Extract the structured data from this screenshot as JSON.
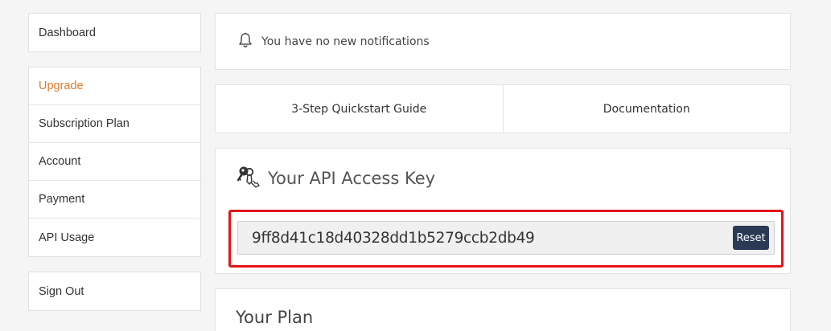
{
  "sidebar": {
    "dashboard": "Dashboard",
    "items": [
      "Upgrade",
      "Subscription Plan",
      "Account",
      "Payment",
      "API Usage"
    ],
    "sign_out": "Sign Out"
  },
  "notifications": {
    "text": "You have no new notifications",
    "icon": "bell-icon"
  },
  "links": {
    "quickstart": "3-Step Quickstart Guide",
    "documentation": "Documentation"
  },
  "api_key": {
    "title": "Your API Access Key",
    "icon": "key-icon",
    "value": "9ff8d41c18d40328dd1b5279ccb2db49",
    "reset_label": "Reset"
  },
  "plan": {
    "title": "Your Plan"
  },
  "colors": {
    "accent": "#e07a2e",
    "highlight": "#e5141b",
    "button": "#2a3a55"
  }
}
